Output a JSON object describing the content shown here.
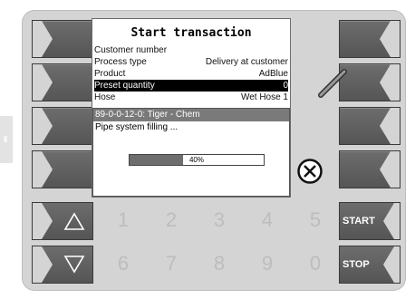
{
  "screen": {
    "title": "Start transaction",
    "fields": [
      {
        "label": "Customer number",
        "value": ""
      },
      {
        "label": "Process type",
        "value": "Delivery at customer"
      },
      {
        "label": "Product",
        "value": "AdBlue"
      },
      {
        "label": "Preset quantity",
        "value": "0"
      },
      {
        "label": "Hose",
        "value": "Wet Hose 1"
      }
    ]
  },
  "dialog": {
    "header": "89-0-0-12-0: Tiger - Chem",
    "message": "Pipe system filling ...",
    "progress_label": "40%",
    "progress_value": 0.4
  },
  "keypad": {
    "digits_row1": [
      "1",
      "2",
      "3",
      "4",
      "5"
    ],
    "digits_row2": [
      "6",
      "7",
      "8",
      "9",
      "0"
    ],
    "start_label": "START",
    "stop_label": "STOP"
  },
  "icons": {
    "edit": "pencil-icon",
    "cancel": "cancel-x-icon",
    "up": "triangle-up-icon",
    "down": "triangle-down-icon"
  },
  "colors": {
    "button_gray": "#5f5f5f",
    "panel_gray": "#d4d4d4",
    "selected_row": "#000000",
    "progress_fill": "#6e6e6e"
  }
}
